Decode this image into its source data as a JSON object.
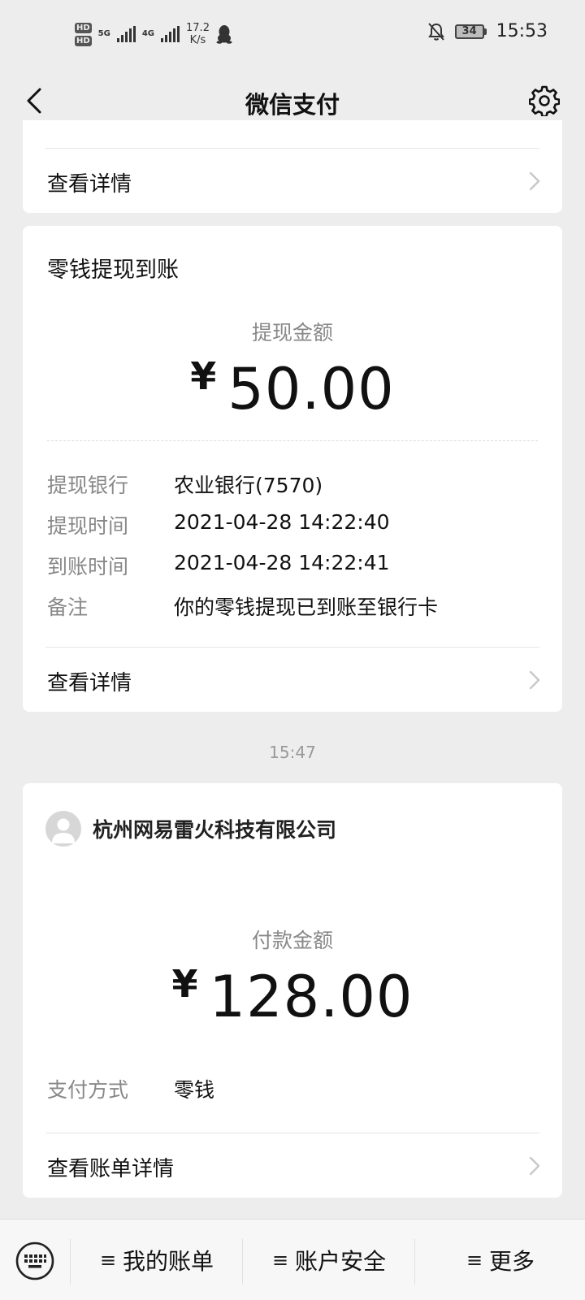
{
  "status_bar": {
    "hd1": "HD",
    "hd2": "HD",
    "net1": "5G",
    "net2": "4G",
    "speed_value": "17.2",
    "speed_unit": "K/s",
    "battery": "34",
    "time": "15:53"
  },
  "nav": {
    "title": "微信支付"
  },
  "cards": {
    "top_partial": {
      "detail_label": "查看详情"
    },
    "withdrawal": {
      "title": "零钱提现到账",
      "amount_caption": "提现金额",
      "currency": "¥",
      "amount": "50.00",
      "rows": [
        {
          "label": "提现银行",
          "value": "农业银行(7570)"
        },
        {
          "label": "提现时间",
          "value": "2021-04-28 14:22:40"
        },
        {
          "label": "到账时间",
          "value": "2021-04-28 14:22:41"
        },
        {
          "label": "备注",
          "value": "你的零钱提现已到账至银行卡"
        }
      ],
      "detail_label": "查看详情"
    },
    "time_separator": "15:47",
    "payment": {
      "merchant": "杭州网易雷火科技有限公司",
      "amount_caption": "付款金额",
      "currency": "¥",
      "amount": "128.00",
      "method_label": "支付方式",
      "method_value": "零钱",
      "detail_label": "查看账单详情"
    }
  },
  "bottom_menu": {
    "items": [
      {
        "glyph": "≡",
        "label": "我的账单"
      },
      {
        "glyph": "≡",
        "label": "账户安全"
      },
      {
        "glyph": "≡",
        "label": "更多"
      }
    ]
  }
}
